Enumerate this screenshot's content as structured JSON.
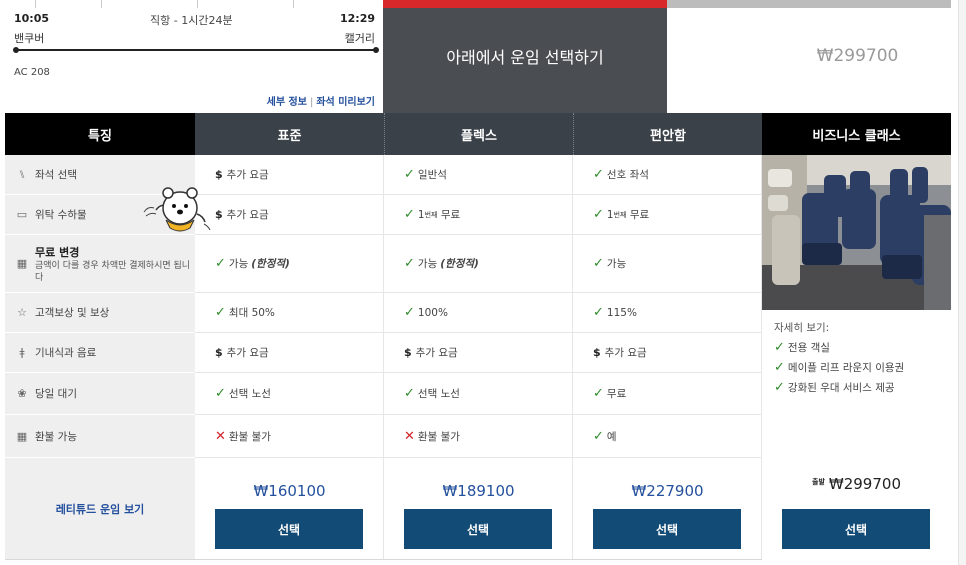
{
  "flight": {
    "departure_time": "10:05",
    "duration": "직항 - 1시간24분",
    "arrival_time": "12:29",
    "origin": "밴쿠버",
    "destination": "캘거리",
    "flight_number": "AC 208",
    "details_link": "세부 정보",
    "seatmap_link": "좌석 미리보기",
    "link_separator": "|"
  },
  "promo": {
    "select_fare_text": "아래에서 운임 선택하기",
    "business_price": "₩299700"
  },
  "header": {
    "features": "특징",
    "standard": "표준",
    "flex": "플렉스",
    "comfort": "편안함",
    "business": "비즈니스 클래스"
  },
  "features": [
    {
      "icon": "seat-icon",
      "label": "좌석 선택"
    },
    {
      "icon": "baggage-icon",
      "label": "위탁 수하물"
    },
    {
      "icon": "calendar-icon",
      "label": "무료 변경",
      "sub": "금액이 다를 경우 차액만 결제하시면 됩니다"
    },
    {
      "icon": "star-icon",
      "label": "고객보상 및 보상"
    },
    {
      "icon": "meal-icon",
      "label": "기내식과 음료"
    },
    {
      "icon": "standby-icon",
      "label": "당일 대기"
    },
    {
      "icon": "refund-icon",
      "label": "환불 가능"
    }
  ],
  "standard": {
    "seat": "추가 요금",
    "bag": "추가 요금",
    "change": "가능",
    "change_note": "(한정적)",
    "miles": "최대 50%",
    "meal": "추가 요금",
    "standby": "선택 노선",
    "refund": "환불 불가",
    "price": "₩160100",
    "button": "선택"
  },
  "flex": {
    "seat": "일반석",
    "bag_prefix": "1",
    "bag_sup": "번째",
    "bag": "무료",
    "change": "가능",
    "change_note": "(한정적)",
    "miles": "100%",
    "meal": "추가 요금",
    "standby": "선택 노선",
    "refund": "환불 불가",
    "price": "₩189100",
    "button": "선택"
  },
  "comfort": {
    "seat": "선호 좌석",
    "bag_prefix": "1",
    "bag_sup": "번째",
    "bag": "무료",
    "change": "가능",
    "miles": "115%",
    "meal": "추가 요금",
    "standby": "무료",
    "refund": "예",
    "price": "₩227900",
    "button": "선택"
  },
  "business": {
    "more": "자세히 보기:",
    "perks": [
      "전용 객실",
      "메이플 리프 라운지 이용권",
      "강화된 우대 서비스 제공"
    ],
    "price_prefix": "출발",
    "price": "₩299700",
    "button": "선택"
  },
  "altitude_link": "레티튜드 운임 보기",
  "symbols": {
    "dollar": "$",
    "check": "✓",
    "cross": "✕"
  },
  "colors": {
    "accent_red": "#d8282a",
    "button_blue": "#124b75",
    "price_blue": "#24509d",
    "check_green": "#2f8a2c",
    "header_slate": "#3b4148"
  }
}
